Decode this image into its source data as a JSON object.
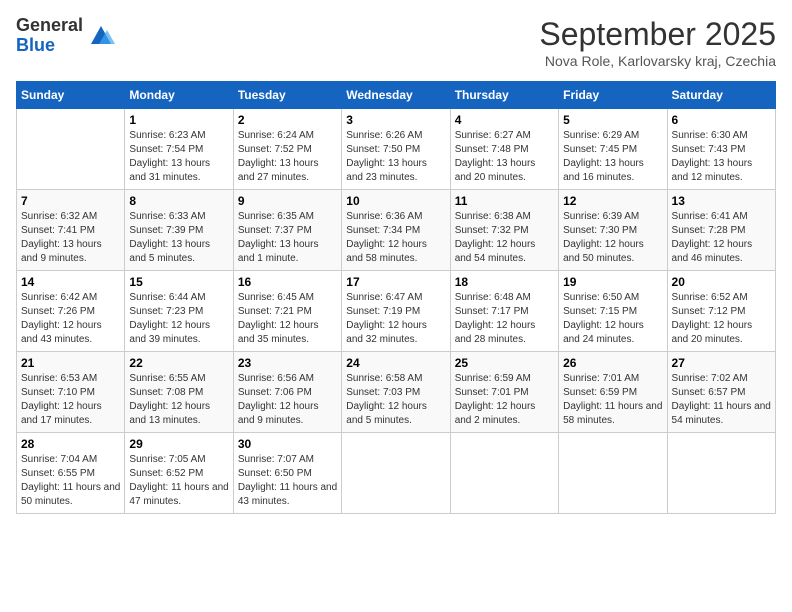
{
  "logo": {
    "general": "General",
    "blue": "Blue"
  },
  "title": "September 2025",
  "location": "Nova Role, Karlovarsky kraj, Czechia",
  "days_of_week": [
    "Sunday",
    "Monday",
    "Tuesday",
    "Wednesday",
    "Thursday",
    "Friday",
    "Saturday"
  ],
  "weeks": [
    [
      {
        "day": "",
        "sunrise": "",
        "sunset": "",
        "daylight": ""
      },
      {
        "day": "1",
        "sunrise": "Sunrise: 6:23 AM",
        "sunset": "Sunset: 7:54 PM",
        "daylight": "Daylight: 13 hours and 31 minutes."
      },
      {
        "day": "2",
        "sunrise": "Sunrise: 6:24 AM",
        "sunset": "Sunset: 7:52 PM",
        "daylight": "Daylight: 13 hours and 27 minutes."
      },
      {
        "day": "3",
        "sunrise": "Sunrise: 6:26 AM",
        "sunset": "Sunset: 7:50 PM",
        "daylight": "Daylight: 13 hours and 23 minutes."
      },
      {
        "day": "4",
        "sunrise": "Sunrise: 6:27 AM",
        "sunset": "Sunset: 7:48 PM",
        "daylight": "Daylight: 13 hours and 20 minutes."
      },
      {
        "day": "5",
        "sunrise": "Sunrise: 6:29 AM",
        "sunset": "Sunset: 7:45 PM",
        "daylight": "Daylight: 13 hours and 16 minutes."
      },
      {
        "day": "6",
        "sunrise": "Sunrise: 6:30 AM",
        "sunset": "Sunset: 7:43 PM",
        "daylight": "Daylight: 13 hours and 12 minutes."
      }
    ],
    [
      {
        "day": "7",
        "sunrise": "Sunrise: 6:32 AM",
        "sunset": "Sunset: 7:41 PM",
        "daylight": "Daylight: 13 hours and 9 minutes."
      },
      {
        "day": "8",
        "sunrise": "Sunrise: 6:33 AM",
        "sunset": "Sunset: 7:39 PM",
        "daylight": "Daylight: 13 hours and 5 minutes."
      },
      {
        "day": "9",
        "sunrise": "Sunrise: 6:35 AM",
        "sunset": "Sunset: 7:37 PM",
        "daylight": "Daylight: 13 hours and 1 minute."
      },
      {
        "day": "10",
        "sunrise": "Sunrise: 6:36 AM",
        "sunset": "Sunset: 7:34 PM",
        "daylight": "Daylight: 12 hours and 58 minutes."
      },
      {
        "day": "11",
        "sunrise": "Sunrise: 6:38 AM",
        "sunset": "Sunset: 7:32 PM",
        "daylight": "Daylight: 12 hours and 54 minutes."
      },
      {
        "day": "12",
        "sunrise": "Sunrise: 6:39 AM",
        "sunset": "Sunset: 7:30 PM",
        "daylight": "Daylight: 12 hours and 50 minutes."
      },
      {
        "day": "13",
        "sunrise": "Sunrise: 6:41 AM",
        "sunset": "Sunset: 7:28 PM",
        "daylight": "Daylight: 12 hours and 46 minutes."
      }
    ],
    [
      {
        "day": "14",
        "sunrise": "Sunrise: 6:42 AM",
        "sunset": "Sunset: 7:26 PM",
        "daylight": "Daylight: 12 hours and 43 minutes."
      },
      {
        "day": "15",
        "sunrise": "Sunrise: 6:44 AM",
        "sunset": "Sunset: 7:23 PM",
        "daylight": "Daylight: 12 hours and 39 minutes."
      },
      {
        "day": "16",
        "sunrise": "Sunrise: 6:45 AM",
        "sunset": "Sunset: 7:21 PM",
        "daylight": "Daylight: 12 hours and 35 minutes."
      },
      {
        "day": "17",
        "sunrise": "Sunrise: 6:47 AM",
        "sunset": "Sunset: 7:19 PM",
        "daylight": "Daylight: 12 hours and 32 minutes."
      },
      {
        "day": "18",
        "sunrise": "Sunrise: 6:48 AM",
        "sunset": "Sunset: 7:17 PM",
        "daylight": "Daylight: 12 hours and 28 minutes."
      },
      {
        "day": "19",
        "sunrise": "Sunrise: 6:50 AM",
        "sunset": "Sunset: 7:15 PM",
        "daylight": "Daylight: 12 hours and 24 minutes."
      },
      {
        "day": "20",
        "sunrise": "Sunrise: 6:52 AM",
        "sunset": "Sunset: 7:12 PM",
        "daylight": "Daylight: 12 hours and 20 minutes."
      }
    ],
    [
      {
        "day": "21",
        "sunrise": "Sunrise: 6:53 AM",
        "sunset": "Sunset: 7:10 PM",
        "daylight": "Daylight: 12 hours and 17 minutes."
      },
      {
        "day": "22",
        "sunrise": "Sunrise: 6:55 AM",
        "sunset": "Sunset: 7:08 PM",
        "daylight": "Daylight: 12 hours and 13 minutes."
      },
      {
        "day": "23",
        "sunrise": "Sunrise: 6:56 AM",
        "sunset": "Sunset: 7:06 PM",
        "daylight": "Daylight: 12 hours and 9 minutes."
      },
      {
        "day": "24",
        "sunrise": "Sunrise: 6:58 AM",
        "sunset": "Sunset: 7:03 PM",
        "daylight": "Daylight: 12 hours and 5 minutes."
      },
      {
        "day": "25",
        "sunrise": "Sunrise: 6:59 AM",
        "sunset": "Sunset: 7:01 PM",
        "daylight": "Daylight: 12 hours and 2 minutes."
      },
      {
        "day": "26",
        "sunrise": "Sunrise: 7:01 AM",
        "sunset": "Sunset: 6:59 PM",
        "daylight": "Daylight: 11 hours and 58 minutes."
      },
      {
        "day": "27",
        "sunrise": "Sunrise: 7:02 AM",
        "sunset": "Sunset: 6:57 PM",
        "daylight": "Daylight: 11 hours and 54 minutes."
      }
    ],
    [
      {
        "day": "28",
        "sunrise": "Sunrise: 7:04 AM",
        "sunset": "Sunset: 6:55 PM",
        "daylight": "Daylight: 11 hours and 50 minutes."
      },
      {
        "day": "29",
        "sunrise": "Sunrise: 7:05 AM",
        "sunset": "Sunset: 6:52 PM",
        "daylight": "Daylight: 11 hours and 47 minutes."
      },
      {
        "day": "30",
        "sunrise": "Sunrise: 7:07 AM",
        "sunset": "Sunset: 6:50 PM",
        "daylight": "Daylight: 11 hours and 43 minutes."
      },
      {
        "day": "",
        "sunrise": "",
        "sunset": "",
        "daylight": ""
      },
      {
        "day": "",
        "sunrise": "",
        "sunset": "",
        "daylight": ""
      },
      {
        "day": "",
        "sunrise": "",
        "sunset": "",
        "daylight": ""
      },
      {
        "day": "",
        "sunrise": "",
        "sunset": "",
        "daylight": ""
      }
    ]
  ]
}
